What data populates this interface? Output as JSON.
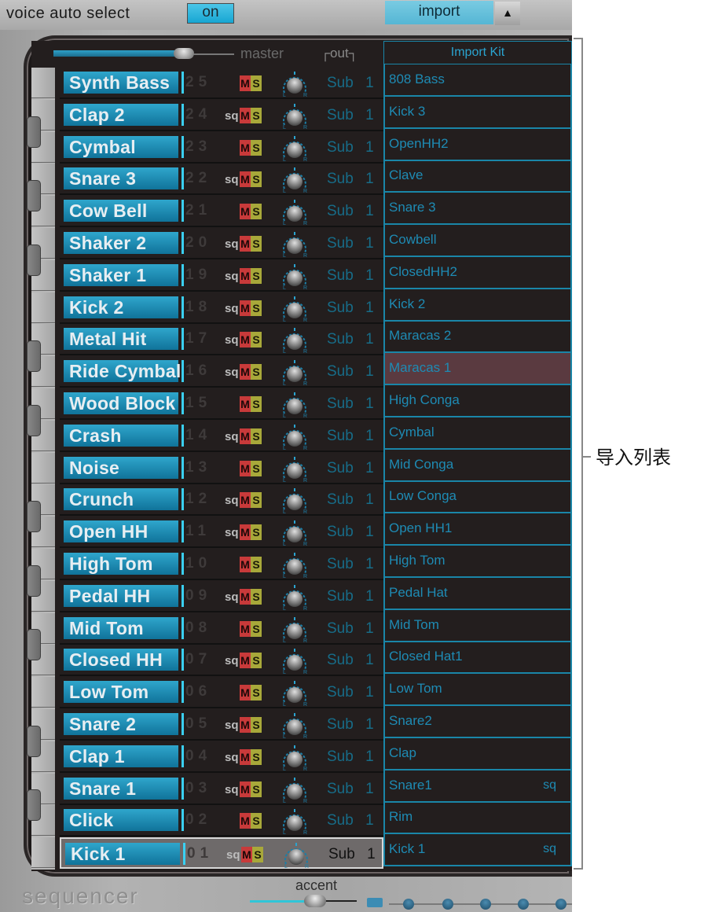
{
  "top_bar": {
    "voice_auto_select_label": "voice auto select",
    "voice_auto_select_value": "on",
    "import_button": "import",
    "import_arrow": "▲"
  },
  "header": {
    "master_label": "master",
    "master_level": 0.72,
    "out_label": "┌out┐",
    "import_kit_label": "Import Kit"
  },
  "voices": [
    {
      "name": "Synth Bass",
      "num": "25",
      "sq": false,
      "out": "Sub 1"
    },
    {
      "name": "Clap 2",
      "num": "24",
      "sq": true,
      "out": "Sub 1"
    },
    {
      "name": "Cymbal",
      "num": "23",
      "sq": false,
      "out": "Sub 1"
    },
    {
      "name": "Snare 3",
      "num": "22",
      "sq": true,
      "out": "Sub 1"
    },
    {
      "name": "Cow Bell",
      "num": "21",
      "sq": false,
      "out": "Sub 1"
    },
    {
      "name": "Shaker 2",
      "num": "20",
      "sq": true,
      "out": "Sub 1"
    },
    {
      "name": "Shaker 1",
      "num": "19",
      "sq": true,
      "out": "Sub 1"
    },
    {
      "name": "Kick 2",
      "num": "18",
      "sq": true,
      "out": "Sub 1"
    },
    {
      "name": "Metal Hit",
      "num": "17",
      "sq": true,
      "out": "Sub 1"
    },
    {
      "name": "Ride Cymbal",
      "num": "16",
      "sq": true,
      "out": "Sub 1"
    },
    {
      "name": "Wood Block",
      "num": "15",
      "sq": false,
      "out": "Sub 1"
    },
    {
      "name": "Crash",
      "num": "14",
      "sq": true,
      "out": "Sub 1"
    },
    {
      "name": "Noise",
      "num": "13",
      "sq": false,
      "out": "Sub 1"
    },
    {
      "name": "Crunch",
      "num": "12",
      "sq": true,
      "out": "Sub 1"
    },
    {
      "name": "Open HH",
      "num": "11",
      "sq": true,
      "out": "Sub 1"
    },
    {
      "name": "High Tom",
      "num": "10",
      "sq": false,
      "out": "Sub 1"
    },
    {
      "name": "Pedal HH",
      "num": "09",
      "sq": true,
      "out": "Sub 1"
    },
    {
      "name": "Mid Tom",
      "num": "08",
      "sq": false,
      "out": "Sub 1"
    },
    {
      "name": "Closed HH",
      "num": "07",
      "sq": true,
      "out": "Sub 1"
    },
    {
      "name": "Low Tom",
      "num": "06",
      "sq": false,
      "out": "Sub 1"
    },
    {
      "name": "Snare 2",
      "num": "05",
      "sq": true,
      "out": "Sub 1"
    },
    {
      "name": "Clap 1",
      "num": "04",
      "sq": true,
      "out": "Sub 1"
    },
    {
      "name": "Snare 1",
      "num": "03",
      "sq": true,
      "out": "Sub 1"
    },
    {
      "name": "Click",
      "num": "02",
      "sq": false,
      "out": "Sub 1"
    },
    {
      "name": "Kick 1",
      "num": "01",
      "sq": true,
      "out": "Sub 1",
      "selected": true
    }
  ],
  "mute_label": "M",
  "solo_label": "S",
  "sq_label": "sq",
  "import_list": [
    {
      "name": "808 Bass"
    },
    {
      "name": "Kick 3"
    },
    {
      "name": "OpenHH2"
    },
    {
      "name": "Clave"
    },
    {
      "name": "Snare 3"
    },
    {
      "name": "Cowbell"
    },
    {
      "name": "ClosedHH2"
    },
    {
      "name": "Kick 2"
    },
    {
      "name": "Maracas 2"
    },
    {
      "name": "Maracas 1",
      "highlight": true
    },
    {
      "name": "High Conga"
    },
    {
      "name": "Cymbal"
    },
    {
      "name": "Mid Conga"
    },
    {
      "name": "Low Conga"
    },
    {
      "name": "Open HH1"
    },
    {
      "name": "High Tom"
    },
    {
      "name": "Pedal Hat"
    },
    {
      "name": "Mid Tom"
    },
    {
      "name": "Closed Hat1"
    },
    {
      "name": "Low Tom"
    },
    {
      "name": "Snare2"
    },
    {
      "name": "Clap"
    },
    {
      "name": "Snare1",
      "sq": "sq"
    },
    {
      "name": "Rim"
    },
    {
      "name": "Kick 1",
      "sq": "sq"
    }
  ],
  "annotation": {
    "label": "导入列表"
  },
  "footer": {
    "sequencer_label": "sequencer",
    "accent_label": "accent",
    "accent_level": 0.6
  },
  "colors": {
    "accent": "#1e8bb4",
    "mute": "#c83a3a",
    "solo": "#a8a83a",
    "highlight": "#5a3a40"
  }
}
